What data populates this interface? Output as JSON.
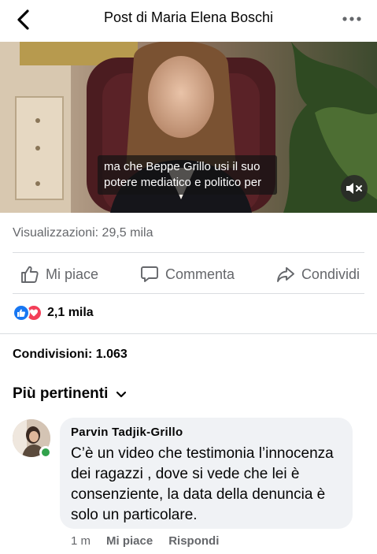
{
  "header": {
    "title": "Post di Maria Elena Boschi",
    "back_icon": "chevron-left-icon",
    "more_icon": "more-horizontal-icon"
  },
  "video": {
    "subtitle_line1": "ma che Beppe Grillo usi il suo",
    "subtitle_line2": "potere mediatico e politico per",
    "mute_icon": "volume-muted-icon"
  },
  "stats": {
    "views": "Visualizzazioni: 29,5 mila",
    "reactions_count": "2,1 mila",
    "shares": "Condivisioni: 1.063"
  },
  "actions": {
    "like": "Mi piace",
    "comment": "Commenta",
    "share": "Condividi"
  },
  "comments": {
    "sort_label": "Più pertinenti",
    "items": [
      {
        "author": "Parvin Tadjik-Grillo",
        "text": "C’è un video che testimonia l’innocenza dei ragazzi , dove si vede che lei è consenziente, la data della denuncia è solo un particolare.",
        "time": "1 m",
        "like_label": "Mi piace",
        "reply_label": "Rispondi"
      }
    ]
  },
  "colors": {
    "accent_blue": "#1877f2",
    "love_red": "#f33e58",
    "online_green": "#31a24c",
    "secondary_text": "#65676b"
  }
}
